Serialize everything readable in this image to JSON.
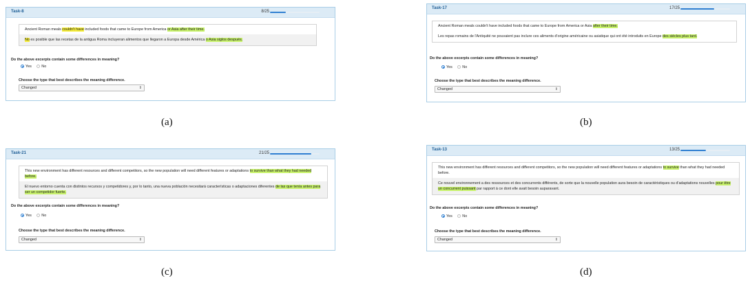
{
  "panels": [
    {
      "task": "Task-8",
      "progress": "8/25",
      "progress_fraction": 0.32,
      "excerpt1": {
        "pre": "Ancient Roman meals ",
        "h1": "couldn't have",
        "mid": " included foods that came to Europe from America ",
        "h2": "or Asia after their time."
      },
      "excerpt2": {
        "h0": "No",
        "pre": " es posible que las recetas de la antigua Roma incluyeran alimentos que llegaron a Europa desde América ",
        "h2": "o Asia siglos después."
      },
      "question": "Do the above excerpts contain some differences in meaning?",
      "yes": "Yes",
      "no": "No",
      "choose": "Choose the type that best describes the meaning difference.",
      "select": "Changed",
      "caption": "(a)"
    },
    {
      "task": "Task-17",
      "progress": "17/25",
      "progress_fraction": 0.68,
      "excerpt1": {
        "pre": "Ancient Roman meals couldn't have included foods that came to Europe from America or Asia ",
        "h2": "after their time."
      },
      "excerpt2": {
        "pre": "Les repas romains de l'Antiquité ne pouvaient pas inclure ces aliments d'origine américaine ou asiatique qui ont été introduits en Europe ",
        "h2": "des siècles plus tard."
      },
      "question": "Do the above excerpts contain some differences in meaning?",
      "yes": "Yes",
      "no": "No",
      "choose": "Choose the type that best describes the meaning difference.",
      "select": "Changed",
      "caption": "(b)"
    },
    {
      "task": "Task-21",
      "progress": "21/25",
      "progress_fraction": 0.84,
      "excerpt1": {
        "pre": "This new environment has different resources and different competitors, so the new population will need different features or adaptations ",
        "h2": "to survive than what they had needed before."
      },
      "excerpt2": {
        "pre": "El nuevo entorno cuenta con distintos recursos y competidores y, por lo tanto, una nueva población necesitará características o adaptaciones diferentes ",
        "h2": "de las que tenía antes para ser un competidor fuerte."
      },
      "question": "Do the above excerpts contain some differences in meaning?",
      "yes": "Yes",
      "no": "No",
      "choose": "Choose the type that best describes the meaning difference.",
      "select": "Changed",
      "caption": "(c)"
    },
    {
      "task": "Task-13",
      "progress": "13/25",
      "progress_fraction": 0.52,
      "excerpt1": {
        "pre": "This new environment has different resources and different competitors, so the new population will need different features or adaptations ",
        "h2": "to survive",
        "post": " than what they had needed before."
      },
      "excerpt2": {
        "pre": "Ce nouvel environnement a des ressources et des concurrents différents, de sorte que la nouvelle population aura besoin de caractéristiques ou d'adaptations nouvelles ",
        "h2": "pour être un concurrent puissant",
        "post": " par rapport à ce dont elle avait besoin auparavant."
      },
      "question": "Do the above excerpts contain some differences in meaning?",
      "yes": "Yes",
      "no": "No",
      "choose": "Choose the type that best describes the meaning difference.",
      "select": "Changed",
      "caption": "(d)"
    }
  ],
  "colors": {
    "highlight_green": "#c8f26b",
    "highlight_yellow": "#f6ee3a",
    "accent_blue": "#2f7fd1",
    "header_bg": "#dcebf6"
  },
  "icons": {
    "radio": "radio-button-icon",
    "select": "select-arrows-icon"
  }
}
